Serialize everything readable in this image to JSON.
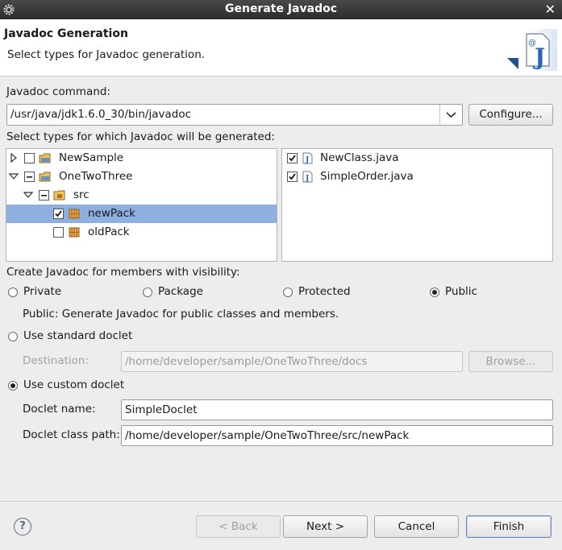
{
  "window": {
    "title": "Generate Javadoc"
  },
  "header": {
    "title": "Javadoc Generation",
    "subtitle": "Select types for Javadoc generation."
  },
  "javadoc_command": {
    "label": "Javadoc command:",
    "value": "/usr/java/jdk1.6.0_30/bin/javadoc",
    "configure_label": "Configure..."
  },
  "types": {
    "label": "Select types for which Javadoc will be generated:",
    "tree": [
      {
        "label": "NewSample",
        "checked": false,
        "expanded": false
      },
      {
        "label": "OneTwoThree",
        "checked": "partial",
        "expanded": true
      },
      {
        "label": "src",
        "checked": "partial",
        "expanded": true
      },
      {
        "label": "newPack",
        "checked": true,
        "selected": true
      },
      {
        "label": "oldPack",
        "checked": false
      }
    ],
    "files": [
      {
        "label": "NewClass.java",
        "checked": true
      },
      {
        "label": "SimpleOrder.java",
        "checked": true
      }
    ]
  },
  "visibility": {
    "label": "Create Javadoc for members with visibility:",
    "options": [
      "Private",
      "Package",
      "Protected",
      "Public"
    ],
    "selected": "Public",
    "description": "Public: Generate Javadoc for public classes and members."
  },
  "standard_doclet": {
    "label": "Use standard doclet",
    "destination_label": "Destination:",
    "destination_value": "/home/developer/sample/OneTwoThree/docs",
    "browse_label": "Browse..."
  },
  "custom_doclet": {
    "label": "Use custom doclet",
    "selected": true,
    "name_label": "Doclet name:",
    "name_value": "SimpleDoclet",
    "classpath_label": "Doclet class path:",
    "classpath_value": "/home/developer/sample/OneTwoThree/src/newPack"
  },
  "footer": {
    "help": "?",
    "back_label": "< Back",
    "next_label": "Next >",
    "cancel_label": "Cancel",
    "finish_label": "Finish"
  }
}
